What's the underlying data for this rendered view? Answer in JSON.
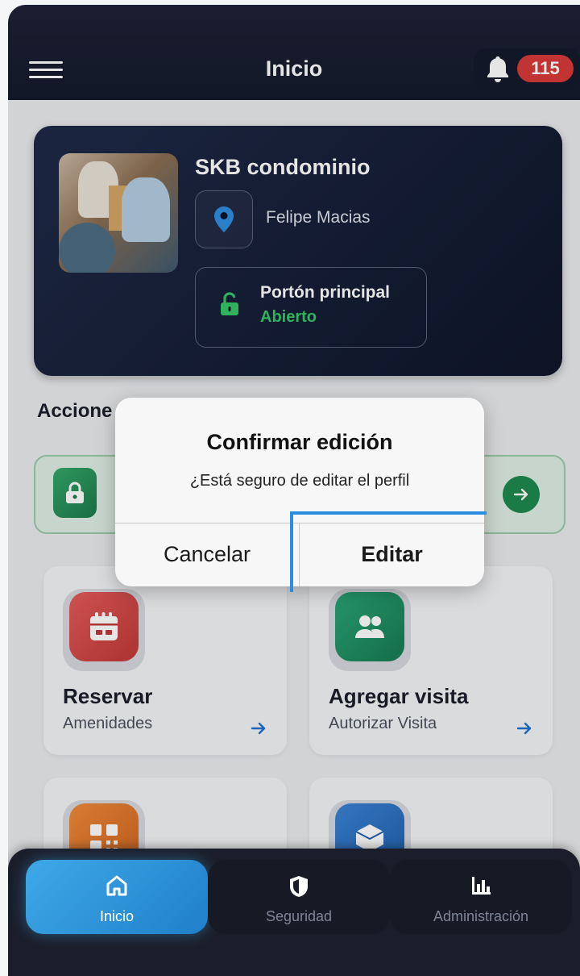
{
  "header": {
    "title": "Inicio",
    "notification_count": "115"
  },
  "card": {
    "title": "SKB condominio",
    "location_name": "Felipe Macias",
    "gate_name": "Portón principal",
    "gate_status": "Abierto",
    "status_color": "#35c767"
  },
  "section": {
    "title": "Accione"
  },
  "tiles": [
    {
      "title": "Reservar",
      "subtitle": "Amenidades",
      "icon": "calendar-icon",
      "color": "#d64545"
    },
    {
      "title": "Agregar visita",
      "subtitle": "Autorizar Visita",
      "icon": "users-icon",
      "color": "#1f8f62"
    },
    {
      "title": "",
      "subtitle": "",
      "icon": "qr-code-icon",
      "color": "#e07a2b"
    },
    {
      "title": "",
      "subtitle": "",
      "icon": "package-icon",
      "color": "#2f6fc0"
    }
  ],
  "dialog": {
    "title": "Confirmar edición",
    "message": "¿Está seguro de editar el perfil",
    "cancel_label": "Cancelar",
    "confirm_label": "Editar"
  },
  "nav": {
    "items": [
      {
        "label": "Inicio",
        "icon": "home-icon",
        "active": true
      },
      {
        "label": "Seguridad",
        "icon": "shield-icon",
        "active": false
      },
      {
        "label": "Administración",
        "icon": "chart-icon",
        "active": false
      }
    ]
  },
  "colors": {
    "accent": "#2f9be0",
    "header_bg": "#1d2236",
    "badge": "#d83a3a"
  }
}
